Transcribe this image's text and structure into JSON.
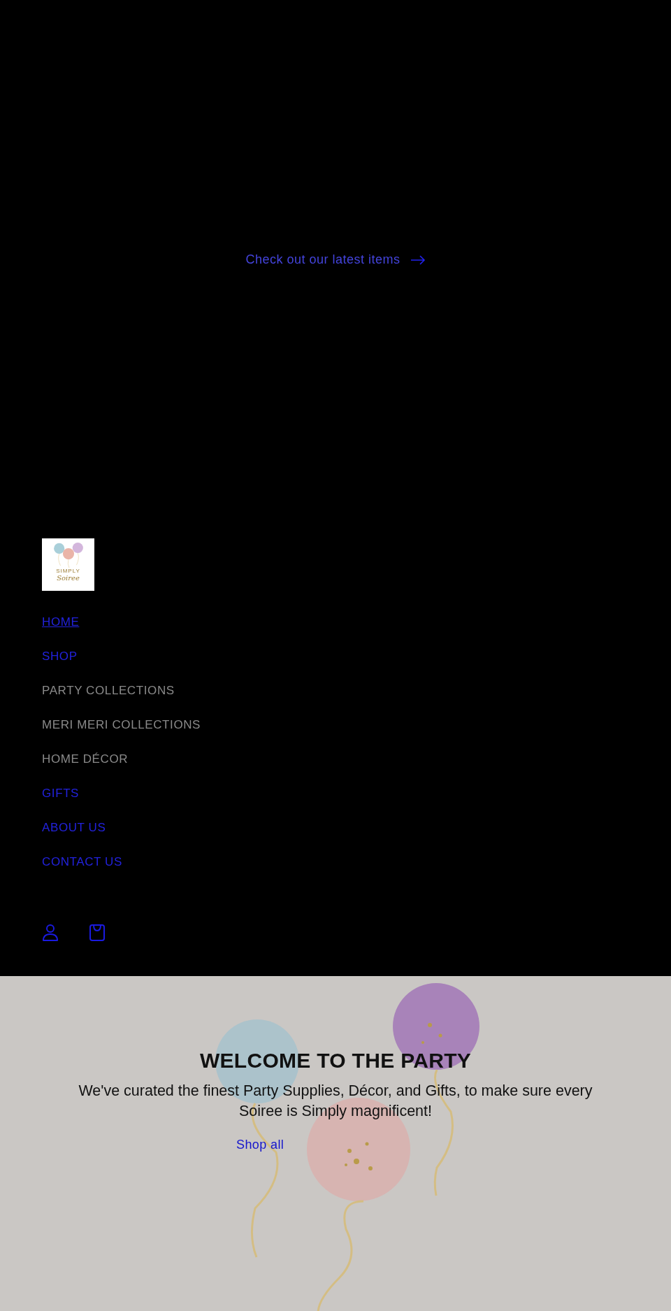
{
  "hero": {
    "link": "Check out our latest items"
  },
  "logo": {
    "line_1": "SIMPLY",
    "line_2": "Soiree"
  },
  "nav": [
    {
      "label": "HOME",
      "kind": "link",
      "selected": true
    },
    {
      "label": "SHOP",
      "kind": "link",
      "selected": false
    },
    {
      "label": "PARTY COLLECTIONS",
      "kind": "group",
      "selected": false
    },
    {
      "label": "MERI MERI COLLECTIONS",
      "kind": "group",
      "selected": false
    },
    {
      "label": "HOME DÉCOR",
      "kind": "group",
      "selected": false
    },
    {
      "label": "GIFTS",
      "kind": "link",
      "selected": false
    },
    {
      "label": "ABOUT US",
      "kind": "link",
      "selected": false
    },
    {
      "label": "CONTACT US",
      "kind": "link",
      "selected": false
    }
  ],
  "banner": {
    "heading": "WELCOME TO THE PARTY",
    "text": "We've curated the finest Party Supplies, Décor, and Gifts, to make sure every Soiree is Simply magnificent!",
    "button": "Shop all"
  }
}
